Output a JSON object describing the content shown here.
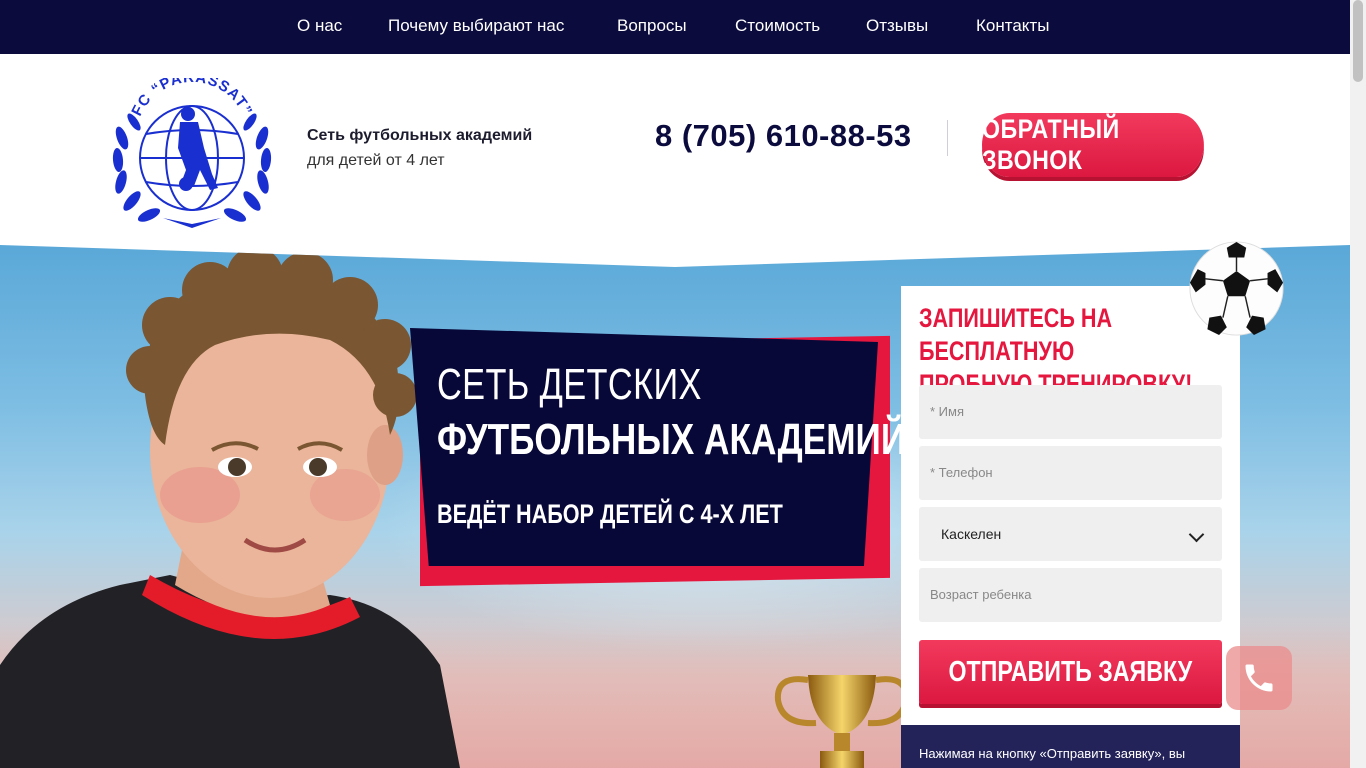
{
  "nav": {
    "items": [
      {
        "label": "О нас"
      },
      {
        "label": "Почему выбирают нас"
      },
      {
        "label": "Вопросы"
      },
      {
        "label": "Стоимость"
      },
      {
        "label": "Отзывы"
      },
      {
        "label": "Контакты"
      }
    ]
  },
  "header": {
    "logo_text": "FC “PARASSAT”",
    "tagline_bold": "Сеть футбольных академий",
    "tagline": "для детей от 4 лет",
    "phone": "8 (705) 610-88-53",
    "callback_label": "ОБРАТНЫЙ ЗВОНОК"
  },
  "hero": {
    "line1": "СЕТЬ ДЕТСКИХ",
    "line2": "ФУТБОЛЬНЫХ АКАДЕМИЙ",
    "line3": "ВЕДЁТ НАБОР ДЕТЕЙ С 4-Х ЛЕТ"
  },
  "form": {
    "title_line1": "ЗАПИШИТЕСЬ НА БЕСПЛАТНУЮ",
    "title_line2": "ПРОБНУЮ ТРЕНИРОВКУ!",
    "name_placeholder": "* Имя",
    "phone_placeholder": "* Телефон",
    "city_selected": "Каскелен",
    "age_placeholder": "Возраст ребенка",
    "submit_label": "ОТПРАВИТЬ ЗАЯВКУ",
    "note": "Нажимая на кнопку «Отправить заявку», вы"
  },
  "colors": {
    "nav_bg": "#0b0b3d",
    "accent": "#e5173f",
    "banner_bg": "#080838"
  },
  "icons": [
    "phone-icon",
    "chevron-down-icon",
    "soccer-ball-icon",
    "trophy-icon"
  ]
}
